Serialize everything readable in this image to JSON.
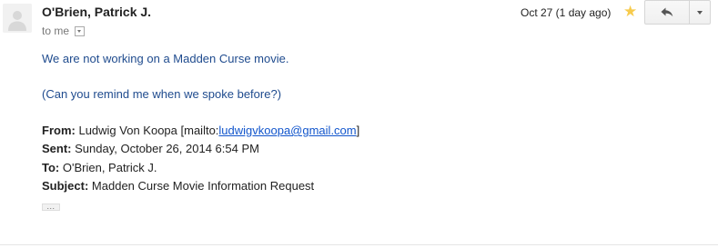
{
  "message": {
    "sender_name": "O'Brien, Patrick J.",
    "recipient_label": "to me",
    "date": "Oct 27 (1 day ago)"
  },
  "body": {
    "line1": "We are not working on a Madden Curse movie.",
    "line2": "(Can you remind me when we spoke before?)"
  },
  "quoted": {
    "from_label": "From:",
    "from_name": "Ludwig Von Koopa [mailto:",
    "from_email": "ludwigvkoopa@gmail.com",
    "from_close": "]",
    "sent_label": "Sent:",
    "sent_value": "Sunday, October 26, 2014 6:54 PM",
    "to_label": "To:",
    "to_value": "O'Brien, Patrick J.",
    "subject_label": "Subject:",
    "subject_value": "Madden Curse Movie Information Request"
  },
  "ellipsis": "...",
  "icons": {
    "avatar": "person-silhouette-icon",
    "star": "star-icon",
    "reply": "reply-arrow-icon",
    "more": "chevron-down-icon"
  },
  "colors": {
    "star": "#f7cb4d",
    "body_text": "#1f4b8e",
    "link": "#1155cc"
  }
}
